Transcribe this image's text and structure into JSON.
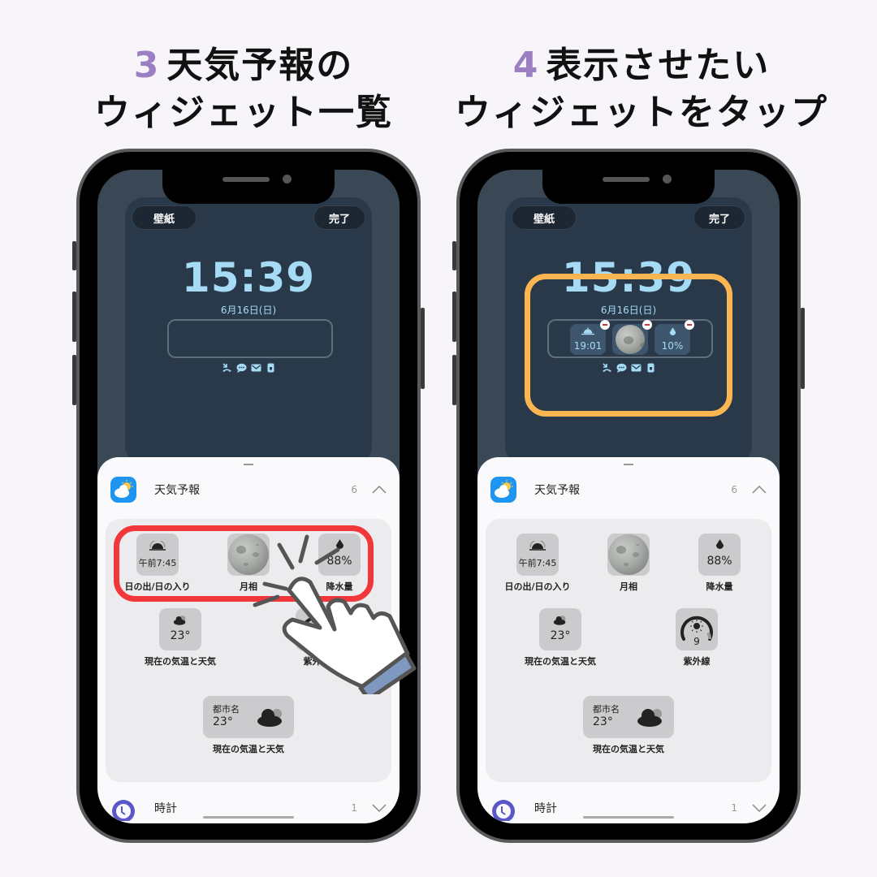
{
  "steps": [
    {
      "number": "3",
      "line1": "天気予報の",
      "line2": "ウィジェット一覧"
    },
    {
      "number": "4",
      "line1": "表示させたい",
      "line2": "ウィジェットをタップ"
    }
  ],
  "colors": {
    "step_number": "#9b7fc2",
    "clock_text": "#a6dbf6",
    "red_highlight": "#f2373b",
    "orange_highlight": "#fbb652",
    "weather_app": "#1e95f0",
    "clock_app": "#5a57c9",
    "hand_cuff": "#7f98c0"
  },
  "lock_screen": {
    "wallpaper_button": "壁紙",
    "done_button": "完了",
    "time": "15:39",
    "date": "6月16日(日)",
    "status_icons": [
      "missed-call-icon",
      "chat-bubble-icon",
      "mail-icon",
      "lock-icon"
    ],
    "added_widgets": [
      {
        "type": "sunset",
        "icon": "sunset-icon",
        "value": "19:01"
      },
      {
        "type": "moon-phase",
        "icon": "moon-icon",
        "value": ""
      },
      {
        "type": "precipitation",
        "icon": "raindrop-icon",
        "value": "10%"
      }
    ]
  },
  "sheet": {
    "weather_app": {
      "name": "天気予報",
      "count": "6",
      "expanded": true
    },
    "clock_app": {
      "name": "時計",
      "count": "1",
      "expanded": false
    },
    "widgets": [
      {
        "label": "日の出/日の入り",
        "value": "午前7:45",
        "icon": "sunrise-icon"
      },
      {
        "label": "月相",
        "value": "",
        "icon": "moon-icon"
      },
      {
        "label": "降水量",
        "value": "88%",
        "icon": "raindrop-icon"
      },
      {
        "label": "現在の気温と天気",
        "value": "23°",
        "icon": "cloud-icon"
      },
      {
        "label": "紫外線",
        "value": "9",
        "icon": "uv-gauge-icon"
      },
      {
        "label": "現在の気温と天気",
        "value": "23°",
        "city": "都市名",
        "icon": "cloud-icon"
      }
    ]
  }
}
